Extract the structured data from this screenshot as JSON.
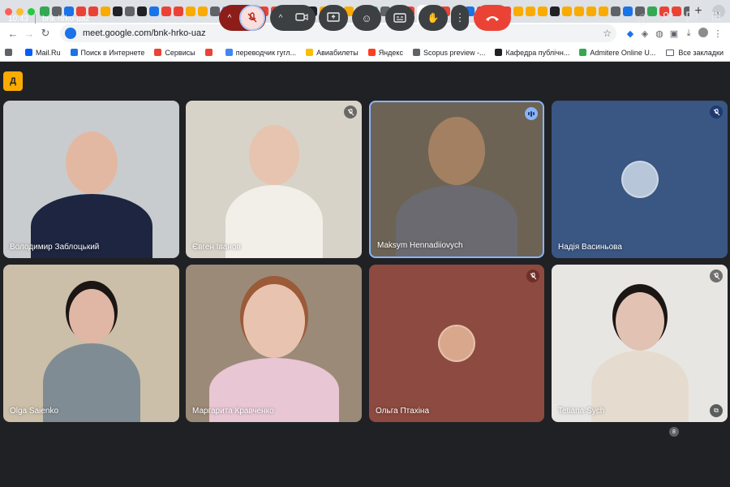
{
  "browser": {
    "active_tab_close": "✕",
    "new_tab": "+",
    "tab_menu": "⌄",
    "url": "meet.google.com/bnk-hrko-uaz",
    "bookmarks": [
      {
        "label": "Mail.Ru",
        "color": "#005ff9"
      },
      {
        "label": "Поиск в Интернете",
        "color": "#1a73e8"
      },
      {
        "label": "Сервисы",
        "color": "#ea4335"
      },
      {
        "label": "",
        "color": "#ea4335"
      },
      {
        "label": "переводчик гугл...",
        "color": "#4285f4"
      },
      {
        "label": "Авиабилеты",
        "color": "#fbbc04"
      },
      {
        "label": "Яндекс",
        "color": "#fc3f1d"
      },
      {
        "label": "Scopus preview -...",
        "color": "#5f6368"
      },
      {
        "label": "Кафедра публічн...",
        "color": "#202124"
      },
      {
        "label": "Admitere Online U...",
        "color": "#34a853"
      }
    ],
    "all_bookmarks": "Все закладки"
  },
  "meet": {
    "logo_text": "Д",
    "time": "10:43",
    "meeting_code": "bnk-hrko-uaz",
    "participant_count": "8",
    "participants": [
      {
        "name": "Володимир Заблоцький",
        "muted": false,
        "speaking": false,
        "has_video": true,
        "bg": "#c9ccce"
      },
      {
        "name": "Євген Іванов",
        "muted": true,
        "speaking": false,
        "has_video": true,
        "bg": "#d8d3c8"
      },
      {
        "name": "Maksym Hennadiiovych",
        "muted": false,
        "speaking": true,
        "has_video": true,
        "bg": "#6d6354"
      },
      {
        "name": "Надія Васиньова",
        "muted": true,
        "speaking": false,
        "has_video": false,
        "bg": "#3a5683"
      },
      {
        "name": "Olga Saienko",
        "muted": false,
        "speaking": false,
        "has_video": true,
        "bg": "#cbbfa9"
      },
      {
        "name": "Маргарита Кравченко",
        "muted": false,
        "speaking": false,
        "has_video": true,
        "bg": "#9b8a78"
      },
      {
        "name": "Ольга Птахіна",
        "muted": true,
        "speaking": false,
        "has_video": false,
        "bg": "#8d4a40"
      },
      {
        "name": "Tetiana Sych",
        "muted": true,
        "speaking": false,
        "has_video": true,
        "bg": "#e8e6e2"
      }
    ]
  },
  "icons": {
    "mic_off": "🎙",
    "chevron_up": "^",
    "camera": "▭",
    "present": "⊞",
    "emoji": "☺",
    "captions": "CC",
    "raise_hand": "✋",
    "more": "⋮",
    "hangup": "☎",
    "info": "ⓘ",
    "people": "👥",
    "chat": "▤",
    "activities": "⠿",
    "pip": "⧉"
  },
  "colors": {
    "background": "#202124",
    "hangup": "#ea4335",
    "speaking_border": "#8ab4f8",
    "mic_off_bg": "#f9dedc"
  }
}
